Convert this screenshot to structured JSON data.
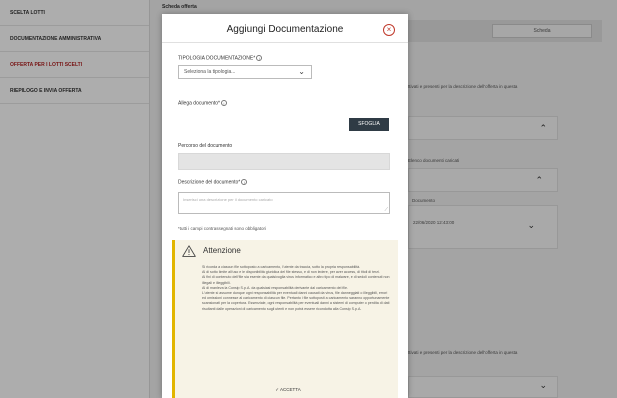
{
  "sidebar": {
    "items": [
      {
        "label": "SCELTA LOTTI",
        "active": false
      },
      {
        "label": "DOCUMENTAZIONE AMMINISTRATIVA",
        "active": false
      },
      {
        "label": "OFFERTA PER I LOTTI SCELTI",
        "active": true
      },
      {
        "label": "RIEPILOGO E INVIA OFFERTA",
        "active": false
      }
    ]
  },
  "background": {
    "section_title": "Scheda offerta",
    "topbar_button": "Scheda",
    "text_1": "ttivati e presenti per la descrizione dell'offerta in questa",
    "text_2": "Elenco documenti caricati",
    "text_3": "Documento",
    "text_4": "22/06/2020 12:43:00",
    "text_5": "ttivati e presenti per la descrizione dell'offerta in questa"
  },
  "modal": {
    "title": "Aggiungi Documentazione",
    "close_glyph": "×",
    "tipologia_label": "TIPOLOGIA DOCUMENTAZIONE*",
    "tipologia_value": "Seleziona la tipologia...",
    "allega_label": "Allega documento*",
    "sfoglia_label": "SFOGLIA",
    "percorso_label": "Percorso del documento",
    "descrizione_label": "Descrizione del documento*",
    "descrizione_placeholder": "Inserisci una descrizione per il documento caricato",
    "required_note": "*tutti i campi contrassegnati sono obbligatori",
    "info_glyph": "i"
  },
  "warning": {
    "title": "Attenzione",
    "paragraphs": [
      "Si ricorda a ciascun file sottoposto a caricamento, l'utente da traccia, sotto la propria responsabilità.",
      "Al di sotto limite all'uso e le disponibilità giuridica del file stesso, e di non ledere, per aver access, di titoli di terzi.",
      "Ai fini di contenuto dell'file sia esente da qualsivoglia virus informatico e altro tipo di malware, e di sedoli contenuti non illegali e illeggibili.",
      "Al di manleva la Consip S.p.A. da qualsiasi responsabilità derivante dal caricamento del file.",
      "L'utente si assume dunque ogni responsabilità per eventuali danni causati da virus, file danneggiati o illeggibili, errori ed omissioni connesse al caricamento di ciascun file. Pertanto i file sottoposti a caricamento saranno opportunamente scansionati per la copertura. Essenziale, ogni responsabilità per eventuali danni a sistemi di computer o perdita di dati risultanti dalle operazioni di caricamento sugli utenti e non potrà essere ricondotta alla Consip S.p.A."
    ],
    "accept_label": "✓ ACCETTA"
  },
  "colors": {
    "accent_red": "#c0392b",
    "button_dark": "#2f3b45",
    "warning_yellow": "#e2b500",
    "warning_bg": "#f7f3e6"
  }
}
